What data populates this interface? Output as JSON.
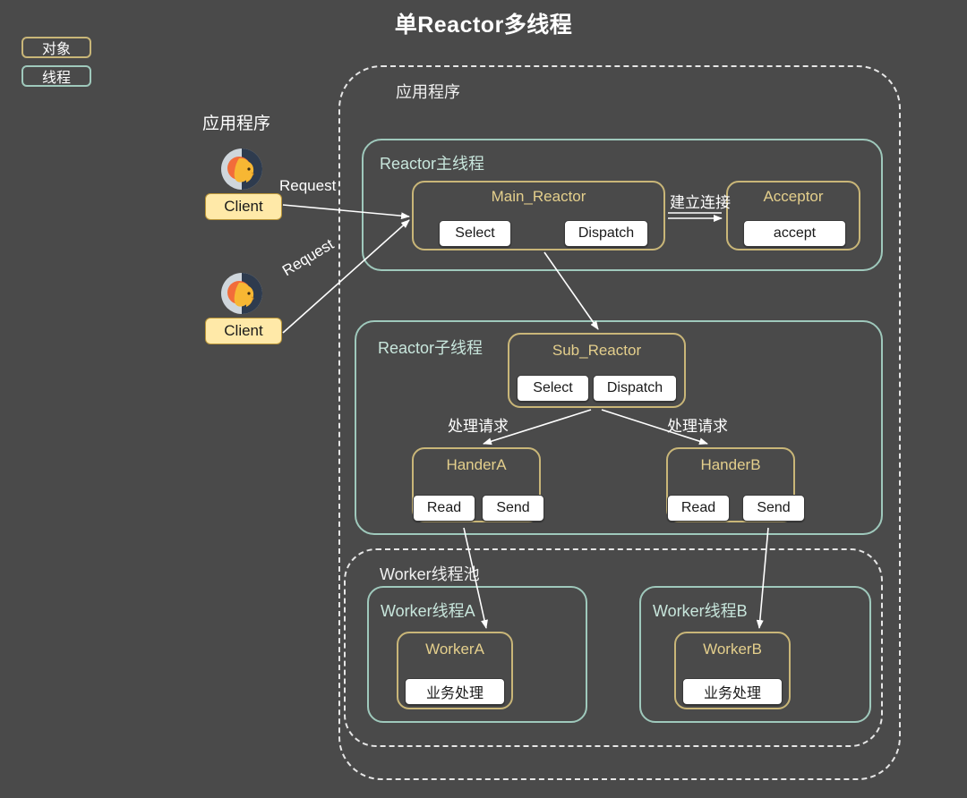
{
  "title": "单Reactor多线程",
  "legend": [
    {
      "label": "对象",
      "color": "#c9b678",
      "name": "object"
    },
    {
      "label": "线程",
      "color": "#9fc9bc",
      "name": "thread"
    }
  ],
  "client_area": {
    "heading": "应用程序",
    "clients": [
      {
        "label": "Client",
        "icon": "user-avatar-icon"
      },
      {
        "label": "Client",
        "icon": "user-avatar-icon"
      }
    ]
  },
  "app_container": {
    "label": "应用程序",
    "style": "dashed"
  },
  "reactor_main_thread": {
    "label": "Reactor主线程",
    "style": "solid-teal",
    "objects": [
      {
        "title": "Main_Reactor",
        "buttons": [
          "Select",
          "Dispatch"
        ]
      },
      {
        "title": "Acceptor",
        "buttons": [
          "accept"
        ]
      }
    ]
  },
  "reactor_sub_thread": {
    "label": "Reactor子线程",
    "style": "solid-teal",
    "objects": [
      {
        "title": "Sub_Reactor",
        "buttons": [
          "Select",
          "Dispatch"
        ]
      },
      {
        "title": "HanderA",
        "buttons": [
          "Read",
          "Send"
        ]
      },
      {
        "title": "HanderB",
        "buttons": [
          "Read",
          "Send"
        ]
      }
    ]
  },
  "worker_pool": {
    "label": "Worker线程池",
    "style": "dashed",
    "threads": [
      {
        "label": "Worker线程A",
        "object": {
          "title": "WorkerA",
          "buttons": [
            "业务处理"
          ]
        }
      },
      {
        "label": "Worker线程B",
        "object": {
          "title": "WorkerB",
          "buttons": [
            "业务处理"
          ]
        }
      }
    ]
  },
  "edges": [
    {
      "label": "Request",
      "name": "client-a-request"
    },
    {
      "label": "Request",
      "name": "client-b-request"
    },
    {
      "label": "建立连接",
      "name": "establish-connection"
    },
    {
      "label": "处理请求",
      "name": "handle-request-a"
    },
    {
      "label": "处理请求",
      "name": "handle-request-b"
    }
  ],
  "colors": {
    "background": "#4a4a4a",
    "object_border": "#c9b678",
    "object_title": "#e4cf8c",
    "thread_border": "#9fc9bc",
    "thread_label": "#c8e6dc",
    "dashed_border": "#e6e6e6",
    "client_fill": "#ffe9a8",
    "arrow": "#ffffff"
  }
}
